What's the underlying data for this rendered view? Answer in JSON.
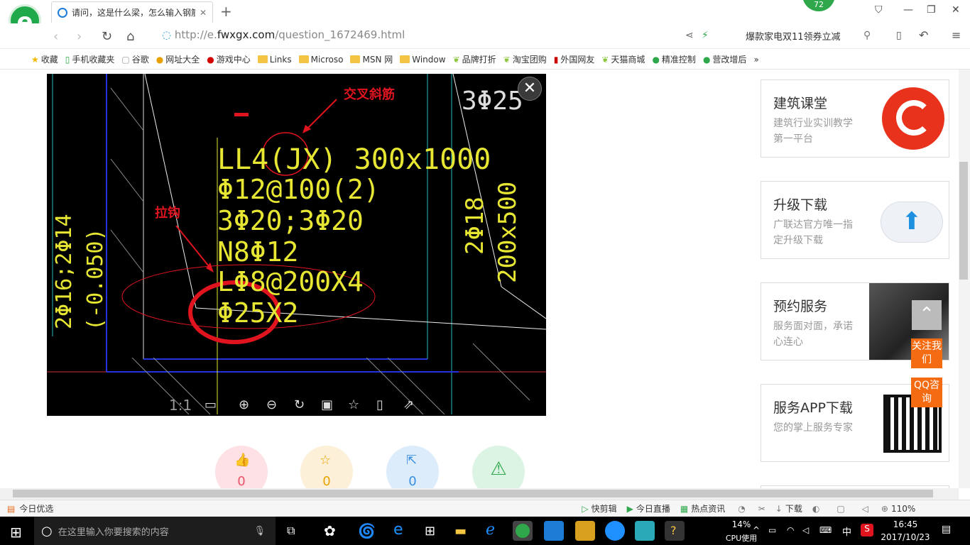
{
  "browser": {
    "tab_title": "请问，这是什么梁，怎么输入钢筋",
    "new_tab": "+",
    "badge": "72",
    "url_prefix": "http://e.",
    "url_domain": "fwxgx.com",
    "url_path": "/question_1672469.html",
    "ad_text": "爆款家电双11领券立减"
  },
  "bookmarks": [
    "收藏",
    "手机收藏夹",
    "谷歌",
    "网址大全",
    "游戏中心",
    "Links",
    "Microso",
    "MSN 网",
    "Window",
    "品牌打折",
    "淘宝团购",
    "外国网友",
    "天猫商城",
    "精准控制",
    "营改增后"
  ],
  "drawing": {
    "annotation_1": "交叉斜筋",
    "annotation_2": "拉钩",
    "beam_label": "LL4(JX) 300x1000",
    "line2": "Φ12@100(2)",
    "line3": "3Φ20;3Φ20",
    "line4": "N8Φ12",
    "line5": "LΦ8@200X4",
    "line6": "Φ25X2",
    "right_top": "3Φ25",
    "right_v1": "2Φ18",
    "right_v2": "200x500",
    "left_v1": "2Φ16;2Φ14",
    "left_v2": "(-0.050)",
    "scale": "1:1"
  },
  "actions": {
    "like_count": "0",
    "fav_count": "0",
    "share_count": "0"
  },
  "sidebar": {
    "cards": [
      {
        "title": "建筑课堂",
        "sub": "建筑行业实训教学第一平台"
      },
      {
        "title": "升级下载",
        "sub": "广联达官方唯一指定升级下载"
      },
      {
        "title": "预约服务",
        "sub": "服务面对面，承诺心连心"
      },
      {
        "title": "服务APP下载",
        "sub": "您的掌上服务专家"
      }
    ],
    "follow": "关注我们",
    "qq": "QQ咨询"
  },
  "status": {
    "left": "今日优选",
    "items": [
      "快剪辑",
      "今日直播",
      "热点资讯",
      "下载"
    ],
    "zoom": "110%"
  },
  "taskbar": {
    "search_placeholder": "在这里输入你要搜索的内容",
    "cpu": "14%",
    "cpu_label": "CPU使用",
    "ime": "中",
    "time": "16:45",
    "date": "2017/10/23"
  },
  "colors": {
    "accent_green": "#2ea84a",
    "cad_yellow": "#e6e633",
    "annotation_red": "#e0141e",
    "orange": "#f46b12"
  }
}
